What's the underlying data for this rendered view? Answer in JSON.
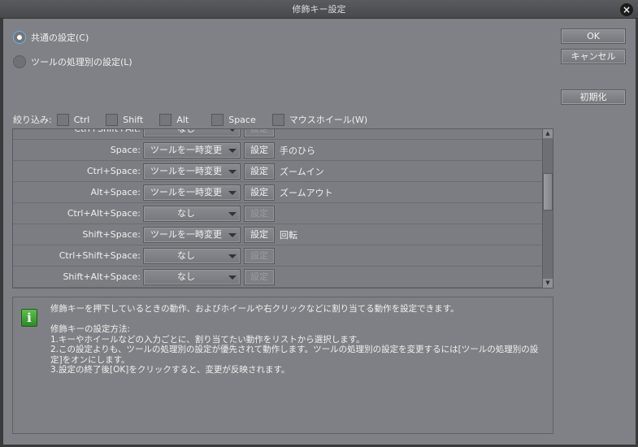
{
  "window": {
    "title": "修飾キー設定"
  },
  "mode": {
    "common": "共通の設定(C)",
    "per_tool": "ツールの処理別の設定(L)",
    "selected": "common"
  },
  "buttons": {
    "ok": "OK",
    "cancel": "キャンセル",
    "reset": "初期化"
  },
  "filter": {
    "label": "絞り込み:",
    "items": [
      "Ctrl",
      "Shift",
      "Alt",
      "Space",
      "マウスホイール(W)"
    ]
  },
  "set_label": "設定",
  "rows": [
    {
      "key": "Ctrl+Shift+Alt:",
      "action": "なし",
      "enabled": false,
      "tool": ""
    },
    {
      "key": "Space:",
      "action": "ツールを一時変更",
      "enabled": true,
      "tool": "手のひら"
    },
    {
      "key": "Ctrl+Space:",
      "action": "ツールを一時変更",
      "enabled": true,
      "tool": "ズームイン"
    },
    {
      "key": "Alt+Space:",
      "action": "ツールを一時変更",
      "enabled": true,
      "tool": "ズームアウト"
    },
    {
      "key": "Ctrl+Alt+Space:",
      "action": "なし",
      "enabled": false,
      "tool": ""
    },
    {
      "key": "Shift+Space:",
      "action": "ツールを一時変更",
      "enabled": true,
      "tool": "回転"
    },
    {
      "key": "Ctrl+Shift+Space:",
      "action": "なし",
      "enabled": false,
      "tool": ""
    },
    {
      "key": "Shift+Alt+Space:",
      "action": "なし",
      "enabled": false,
      "tool": ""
    }
  ],
  "info": {
    "lines": [
      "修飾キーを押下しているときの動作、およびホイールや右クリックなどに割り当てる動作を設定できます。",
      "",
      "修飾キーの設定方法:",
      "1.キーやホイールなどの入力ごとに、割り当てたい動作をリストから選択します。",
      "2.この設定よりも、ツールの処理別の設定が優先されて動作します。ツールの処理別の設定を変更するには[ツールの処理別の設定]をオンにします。",
      "3.設定の終了後[OK]をクリックすると、変更が反映されます。"
    ]
  }
}
